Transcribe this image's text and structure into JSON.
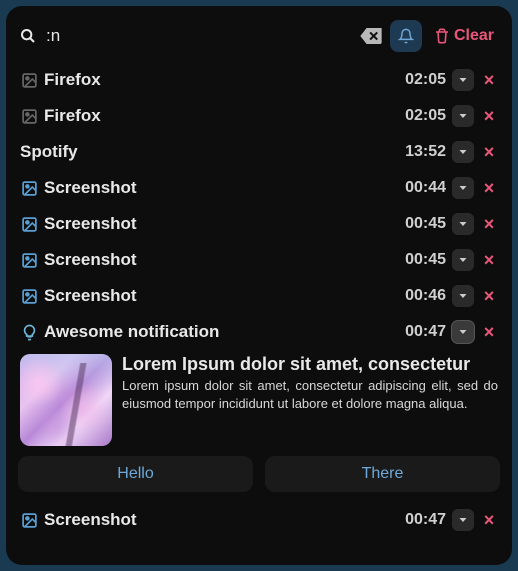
{
  "search": {
    "value": ":n"
  },
  "clear_label": "Clear",
  "items": [
    {
      "icon": "image-dark",
      "title": "Firefox",
      "time": "02:05",
      "expanded": false
    },
    {
      "icon": "image-dark",
      "title": "Firefox",
      "time": "02:05",
      "expanded": false
    },
    {
      "icon": "none",
      "title": "Spotify",
      "time": "13:52",
      "expanded": false
    },
    {
      "icon": "image",
      "title": "Screenshot",
      "time": "00:44",
      "expanded": false
    },
    {
      "icon": "image",
      "title": "Screenshot",
      "time": "00:45",
      "expanded": false
    },
    {
      "icon": "image",
      "title": "Screenshot",
      "time": "00:45",
      "expanded": false
    },
    {
      "icon": "image",
      "title": "Screenshot",
      "time": "00:46",
      "expanded": false
    },
    {
      "icon": "bulb",
      "title": "Awesome notification",
      "time": "00:47",
      "expanded": true,
      "detail_title": "Lorem Ipsum dolor sit amet, consectetur",
      "detail_body": "Lorem ipsum dolor sit amet, consectetur adipiscing elit, sed do eiusmod tempor incididunt ut labore et dolore magna aliqua.",
      "actions": [
        "Hello",
        "There"
      ]
    },
    {
      "icon": "image",
      "title": "Screenshot",
      "time": "00:47",
      "expanded": false
    }
  ]
}
